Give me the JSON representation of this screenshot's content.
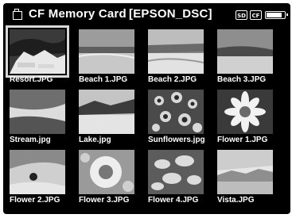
{
  "header": {
    "title": "CF Memory Card [EPSON_DSC]",
    "sd_label": "SD",
    "cf_label": "CF",
    "battery_level": 0.9
  },
  "thumbnails": [
    {
      "name": "Resort.JPG",
      "selected": true,
      "scene": "resort"
    },
    {
      "name": "Beach 1.JPG",
      "selected": false,
      "scene": "beach1"
    },
    {
      "name": "Beach 2.JPG",
      "selected": false,
      "scene": "beach2"
    },
    {
      "name": "Beach 3.JPG",
      "selected": false,
      "scene": "beach3"
    },
    {
      "name": "Stream.jpg",
      "selected": false,
      "scene": "stream"
    },
    {
      "name": "Lake.jpg",
      "selected": false,
      "scene": "lake"
    },
    {
      "name": "Sunflowers.jpg",
      "selected": false,
      "scene": "sunflowers"
    },
    {
      "name": "Flower 1.JPG",
      "selected": false,
      "scene": "flower1"
    },
    {
      "name": "Flower 2.JPG",
      "selected": false,
      "scene": "flower2"
    },
    {
      "name": "Flower 3.JPG",
      "selected": false,
      "scene": "flower3"
    },
    {
      "name": "Flower 4.JPG",
      "selected": false,
      "scene": "flower4"
    },
    {
      "name": "Vista.JPG",
      "selected": false,
      "scene": "vista"
    }
  ]
}
